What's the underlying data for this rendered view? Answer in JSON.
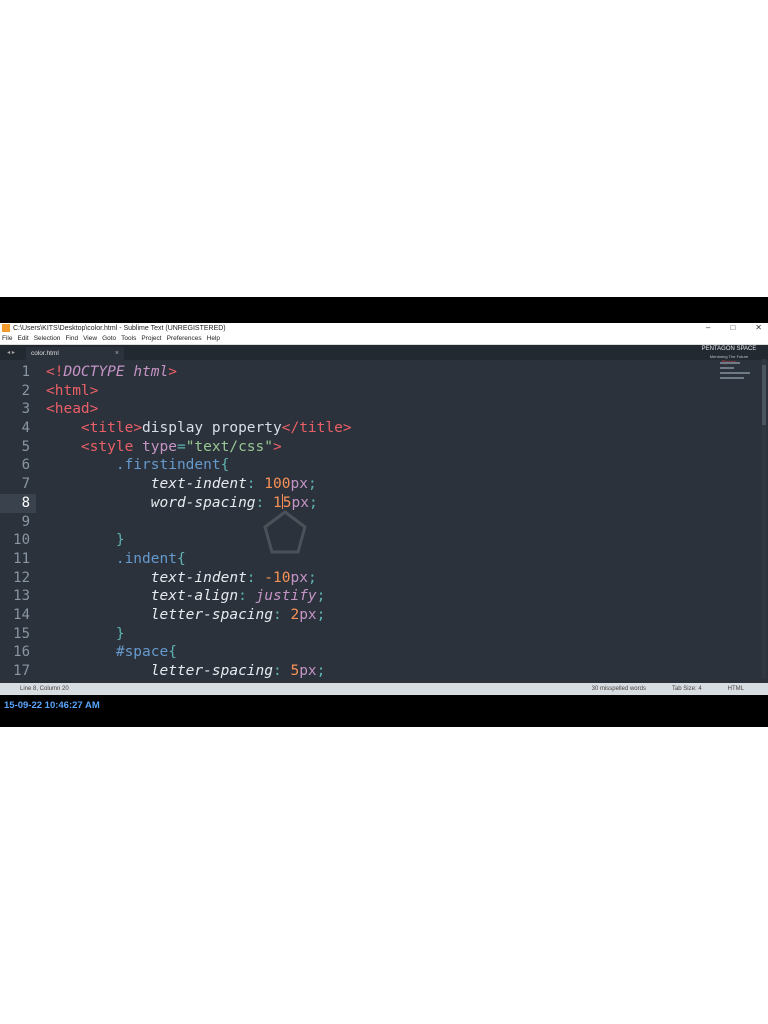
{
  "window": {
    "title": "C:\\Users\\KITS\\Desktop\\color.html - Sublime Text (UNREGISTERED)",
    "controls": [
      "–",
      "□",
      "✕"
    ]
  },
  "menu": [
    "File",
    "Edit",
    "Selection",
    "Find",
    "View",
    "Goto",
    "Tools",
    "Project",
    "Preferences",
    "Help"
  ],
  "tabs": [
    {
      "label": "color.html",
      "close": "×"
    }
  ],
  "tab_nav": "◂ ▸",
  "brand": {
    "name": "PENTAGON SPACE",
    "tagline": "Mentoring The Future",
    "extra": "Space"
  },
  "editor": {
    "line_numbers": [
      "1",
      "2",
      "3",
      "4",
      "5",
      "6",
      "7",
      "8",
      "9",
      "10",
      "11",
      "12",
      "13",
      "14",
      "15",
      "16",
      "17"
    ],
    "active_line": 8,
    "lines": [
      "<!DOCTYPE html>",
      "<html>",
      "<head>",
      "    <title>display property</title>",
      "    <style type=\"text/css\">",
      "        .firstindent{",
      "            text-indent: 100px;",
      "            word-spacing: 15px;",
      "",
      "        }",
      "        .indent{",
      "            text-indent: -10px;",
      "            text-align: justify;",
      "            letter-spacing: 2px;",
      "        }",
      "        #space{",
      "            letter-spacing: 5px;"
    ]
  },
  "status": {
    "position": "Line 8, Column 20",
    "spell": "30 misspelled words",
    "tab_size": "Tab Size: 4",
    "syntax": "HTML"
  },
  "timestamp": "15-09-22 10:46:27 AM",
  "colors": {
    "editor_bg": "#2b323b",
    "tag": "#ec5f67",
    "string": "#99c794",
    "number": "#f99157",
    "unit": "#c594c5",
    "timestamp": "#58a6ff"
  }
}
